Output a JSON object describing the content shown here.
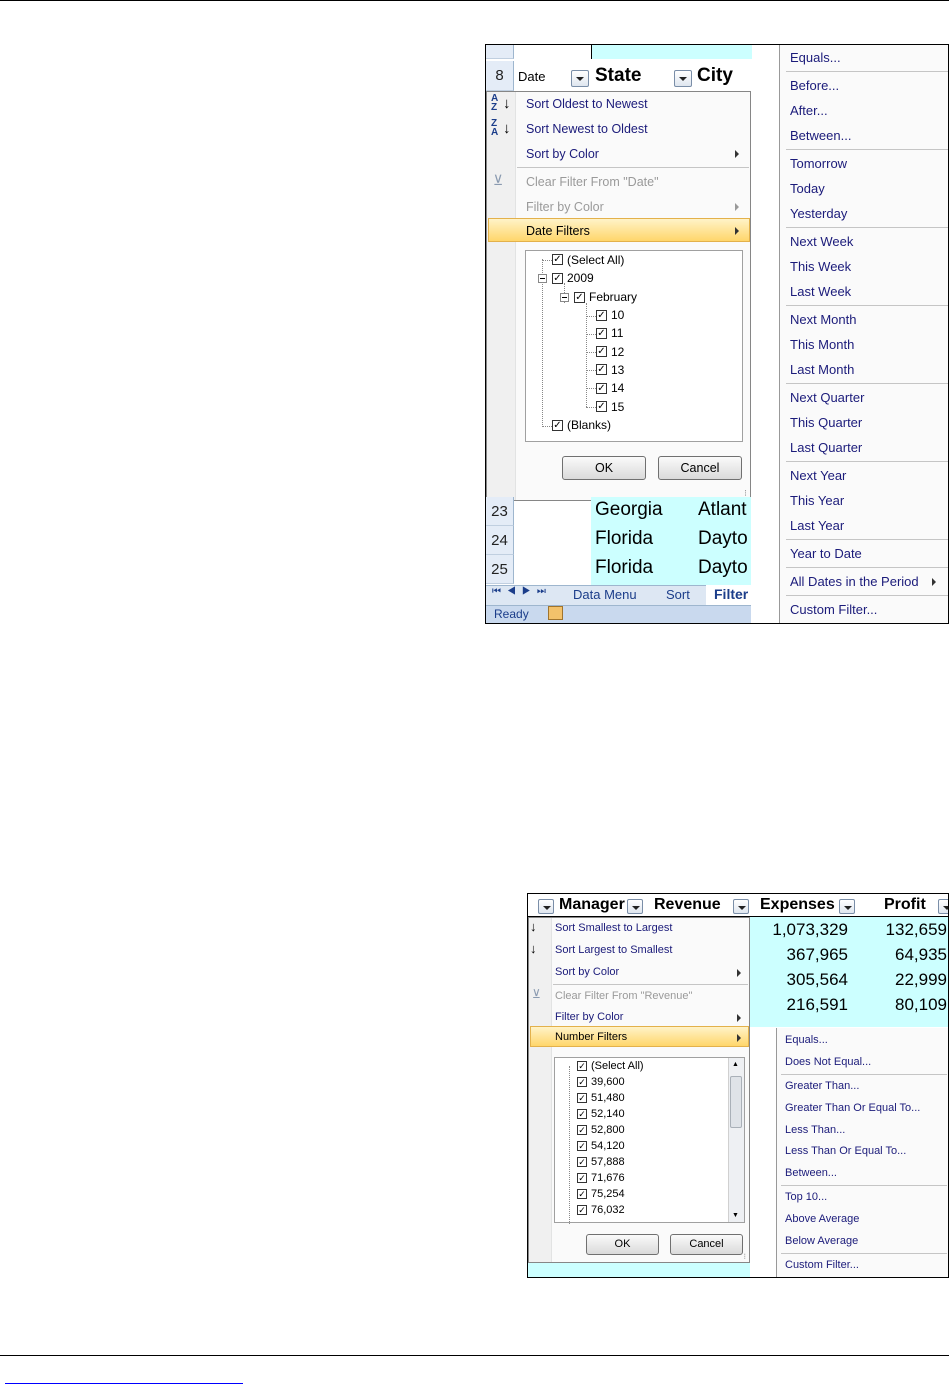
{
  "date_filter_screenshot": {
    "row_numbers": [
      "8",
      "23",
      "24",
      "25"
    ],
    "headers": {
      "date": "Date",
      "state": "State",
      "city": "City"
    },
    "sort_menu": {
      "sort_oldest": "Sort Oldest to Newest",
      "sort_newest": "Sort Newest to Oldest",
      "sort_by_color": "Sort by Color",
      "clear_filter": "Clear Filter From \"Date\"",
      "filter_by_color": "Filter by Color",
      "date_filters": "Date Filters"
    },
    "tree": {
      "select_all": "(Select All)",
      "year": "2009",
      "month": "February",
      "days": [
        "10",
        "11",
        "12",
        "13",
        "14",
        "15"
      ],
      "blanks": "(Blanks)"
    },
    "ok": "OK",
    "cancel": "Cancel",
    "sheet_rows": [
      {
        "state": "Georgia",
        "city": "Atlant"
      },
      {
        "state": "Florida",
        "city": "Dayto"
      },
      {
        "state": "Florida",
        "city": "Dayto"
      }
    ],
    "sheet_tabs": [
      "Data Menu",
      "Sort",
      "Filter"
    ],
    "status": "Ready",
    "submenu": [
      "Equals...",
      "Before...",
      "After...",
      "Between...",
      "Tomorrow",
      "Today",
      "Yesterday",
      "Next Week",
      "This Week",
      "Last Week",
      "Next Month",
      "This Month",
      "Last Month",
      "Next Quarter",
      "This Quarter",
      "Last Quarter",
      "Next Year",
      "This Year",
      "Last Year",
      "Year to Date",
      "All Dates in the Period",
      "Custom Filter..."
    ]
  },
  "number_filter_screenshot": {
    "headers": {
      "manager": "Manager",
      "revenue": "Revenue",
      "expenses": "Expenses",
      "profit": "Profit"
    },
    "rows": [
      {
        "expenses": "1,073,329",
        "profit": "132,659"
      },
      {
        "expenses": "367,965",
        "profit": "64,935"
      },
      {
        "expenses": "305,564",
        "profit": "22,999"
      },
      {
        "expenses": "216,591",
        "profit": "80,109"
      }
    ],
    "sort_menu": {
      "sort_smallest": "Sort Smallest to Largest",
      "sort_largest": "Sort Largest to Smallest",
      "sort_by_color": "Sort by Color",
      "clear_filter": "Clear Filter From \"Revenue\"",
      "filter_by_color": "Filter by Color",
      "number_filters": "Number Filters"
    },
    "list": {
      "select_all": "(Select All)",
      "values": [
        "39,600",
        "51,480",
        "52,140",
        "52,800",
        "54,120",
        "57,888",
        "71,676",
        "75,254",
        "76,032"
      ]
    },
    "ok": "OK",
    "cancel": "Cancel",
    "submenu": [
      "Equals...",
      "Does Not Equal...",
      "Greater Than...",
      "Greater Than Or Equal To...",
      "Less Than...",
      "Less Than Or Equal To...",
      "Between...",
      "Top 10...",
      "Above Average",
      "Below Average",
      "Custom Filter..."
    ]
  },
  "colors": {
    "cell_highlight": "#ccffff",
    "menu_highlight": "#ffd66b",
    "link": "#0000ff"
  }
}
